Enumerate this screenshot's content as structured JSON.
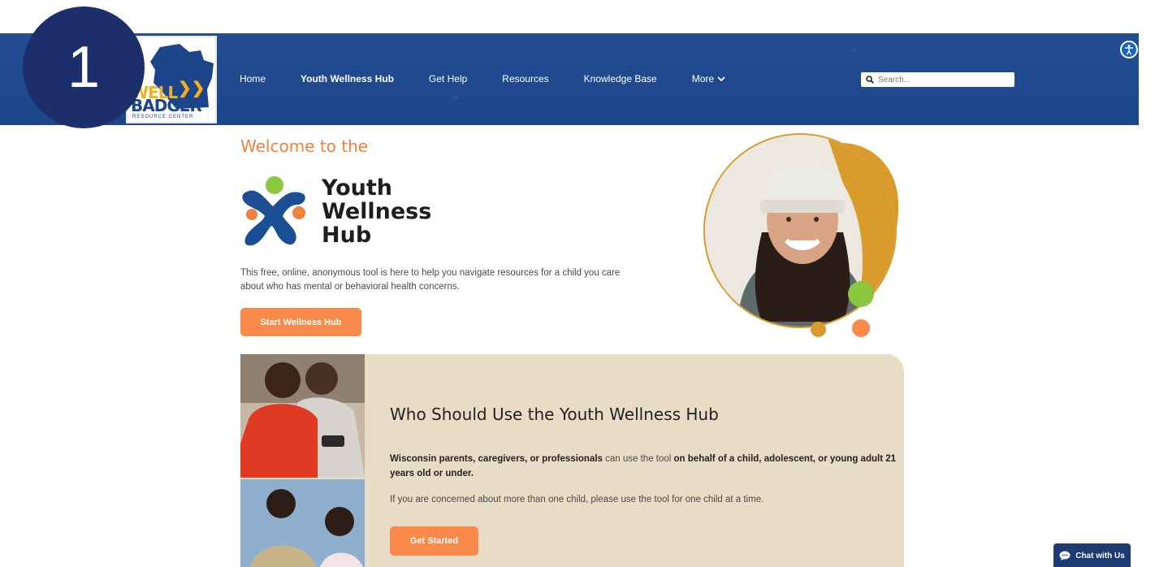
{
  "step_number": "1",
  "header": {
    "logo": {
      "line1": "WELL",
      "line2": "BADGER",
      "line3": "RESOURCE CENTER"
    },
    "nav": [
      {
        "label": "Home",
        "active": false
      },
      {
        "label": "Youth Wellness Hub",
        "active": true
      },
      {
        "label": "Get Help",
        "active": false
      },
      {
        "label": "Resources",
        "active": false
      },
      {
        "label": "Knowledge Base",
        "active": false
      },
      {
        "label": "More",
        "active": false,
        "has_dropdown": true
      }
    ],
    "search": {
      "placeholder": "Search...",
      "icon": "search-icon"
    },
    "accessibility_icon": "accessibility-icon"
  },
  "hero": {
    "welcome": "Welcome to the",
    "hub_logo_text": [
      "Youth",
      "Wellness",
      "Hub"
    ],
    "intro": "This free, online, anonymous tool is here to help you navigate resources for a child you care about who has mental or behavioral health concerns.",
    "start_button": "Start Wellness Hub"
  },
  "card": {
    "title": "Who Should Use the Youth Wellness Hub",
    "p1_parts": [
      "Wisconsin parents, caregivers, or professionals",
      " can use the tool ",
      "on behalf of a child, adolescent, or young adult 21 years old or under."
    ],
    "p2": "If you are concerned about more than one child, please use the tool for one child at a time.",
    "button": "Get Started"
  },
  "chat": {
    "label": "Chat with Us",
    "icon": "chat-bubble-icon"
  },
  "colors": {
    "header_blue": "#204a8f",
    "orange": "#f98a4b",
    "card_bg": "#e8dcc5",
    "badge": "#1d2f6b",
    "gold": "#d99b2b",
    "green": "#8dc63f"
  }
}
